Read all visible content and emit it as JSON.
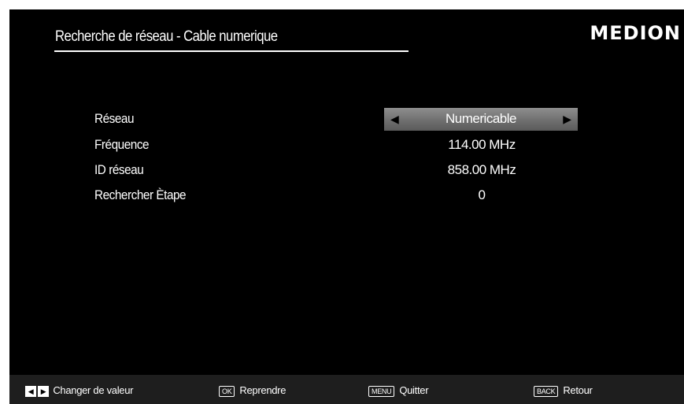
{
  "header": {
    "title": "Recherche de réseau - Cable numerique",
    "brand": "MEDION"
  },
  "rows": [
    {
      "label": "Réseau",
      "value": "Numericable"
    },
    {
      "label": "Fréquence",
      "value": "114.00 MHz"
    },
    {
      "label": "ID réseau",
      "value": "858.00 MHz"
    },
    {
      "label": "Rechercher Ètape",
      "value": "0"
    }
  ],
  "selector": {
    "left_arrow": "◀",
    "right_arrow": "▶"
  },
  "footer": {
    "change_label": "Changer de valeur",
    "ok_key": "OK",
    "ok_label": "Reprendre",
    "menu_key": "MENU",
    "menu_label": "Quitter",
    "back_key": "BACK",
    "back_label": "Retour",
    "left_key": "◀",
    "right_key": "▶"
  },
  "colors": {
    "background": "#000000",
    "text": "#ffffff",
    "selector": "#7a7a7a",
    "footer": "#1e1e1e"
  }
}
